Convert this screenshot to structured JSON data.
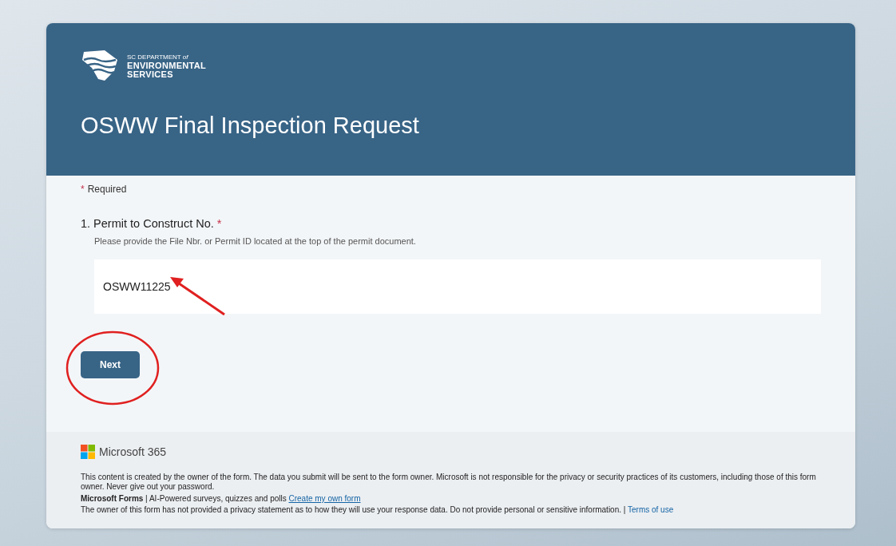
{
  "logo": {
    "lines": [
      "SC DEPARTMENT *of*",
      "ENVIRONMENTAL",
      "SERVICES"
    ]
  },
  "form_title": "OSWW Final Inspection Request",
  "required_note": {
    "mark": "*",
    "label": "Required"
  },
  "questions": [
    {
      "number": "1.",
      "label": "Permit to Construct No.",
      "required": true,
      "hint": "Please provide the File Nbr. or Permit ID located at the top of the permit document.",
      "value": "OSWW11225"
    }
  ],
  "next_button": "Next",
  "footer": {
    "brand": "Microsoft 365",
    "disclaimer": "This content is created by the owner of the form. The data you submit will be sent to the form owner. Microsoft is not responsible for the privacy or security practices of its customers, including those of this form owner. Never give out your password.",
    "forms_line": "**Microsoft Forms** | AI-Powered surveys, quizzes and polls",
    "forms_link": "Create my own form",
    "privacy_line": "The owner of this form has not provided a privacy statement as to how they will use your response data. Do not provide personal or sensitive information. |",
    "privacy_link": "Terms of use"
  }
}
